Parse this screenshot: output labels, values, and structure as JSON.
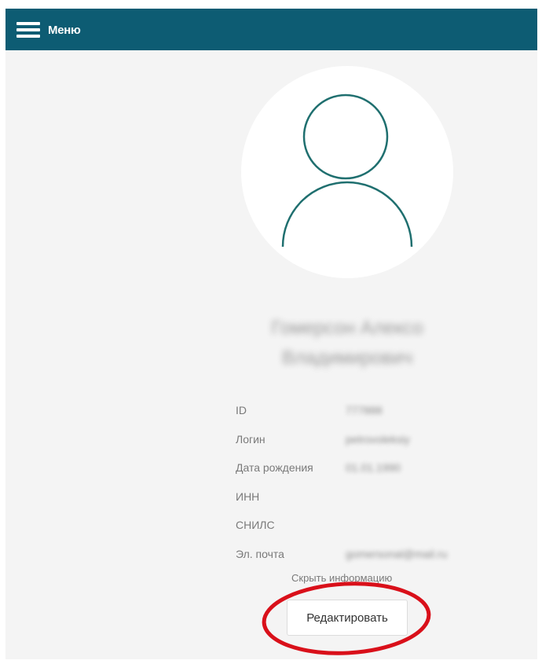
{
  "header": {
    "menu_label": "Меню",
    "menu_icon": "hamburger-icon",
    "color": "#0d5c73"
  },
  "profile": {
    "avatar_icon": "user-placeholder-icon",
    "avatar_color": "#1f6f6f",
    "fullname_line1": "Гомерсон Алексо",
    "fullname_line2": "Владимирович"
  },
  "info": {
    "rows": [
      {
        "label": "ID",
        "value": "777888"
      },
      {
        "label": "Логин",
        "value": "petrovoleksiy"
      },
      {
        "label": "Дата рождения",
        "value": "01.01.1990"
      },
      {
        "label": "ИНН",
        "value": ""
      },
      {
        "label": "СНИЛС",
        "value": ""
      },
      {
        "label": "Эл. почта",
        "value": "gomersonal@mail.ru"
      }
    ]
  },
  "actions": {
    "hide_info": "Скрыть информацию",
    "edit": "Редактировать",
    "highlight_color": "#d9101a"
  }
}
